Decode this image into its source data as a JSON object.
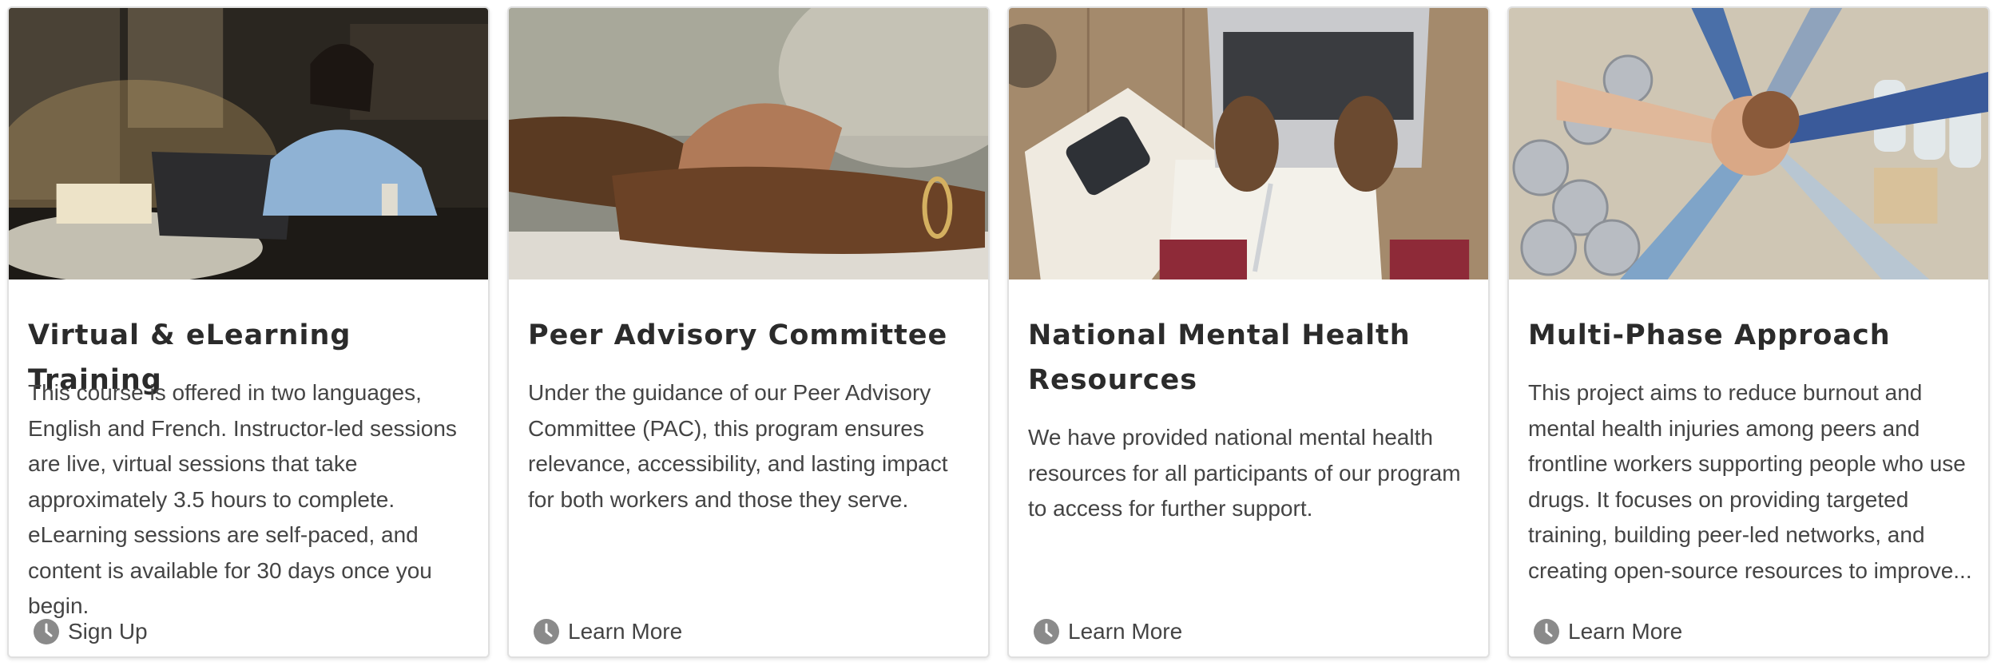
{
  "cards": [
    {
      "title": "Virtual & eLearning Training",
      "description": "This course is offered in two languages, English and French. Instructor-led sessions are live, virtual sessions that take approximately 3.5 hours to complete. eLearning sessions are self-paced, and content is available for 30 days once you begin.",
      "action_label": "Sign Up",
      "image": "nurse-studying-laptop-night"
    },
    {
      "title": "Peer Advisory Committee",
      "description": "Under the guidance of our Peer Advisory Committee (PAC), this program ensures relevance, accessibility, and lasting impact for both workers and those they serve.",
      "action_label": "Learn More",
      "image": "clasped-hands-support"
    },
    {
      "title": "National Mental Health Resources",
      "description": "We have provided national mental health resources for all participants of our program to access for further support.",
      "action_label": "Learn More",
      "image": "hands-typing-laptop-desk"
    },
    {
      "title": "Multi-Phase Approach",
      "description": "This project aims to reduce burnout and mental health injuries among peers and frontline workers supporting people who use drugs. It focuses on providing targeted training, building peer-led networks, and creating open-source resources to improve...",
      "action_label": "Learn More",
      "image": "team-hands-stacked-food-drive"
    }
  ],
  "icons": {
    "action": "clock-icon"
  },
  "colors": {
    "title": "#2b2b2b",
    "text": "#444444",
    "icon": "#8a8a8a",
    "border": "#e0e0e0"
  }
}
